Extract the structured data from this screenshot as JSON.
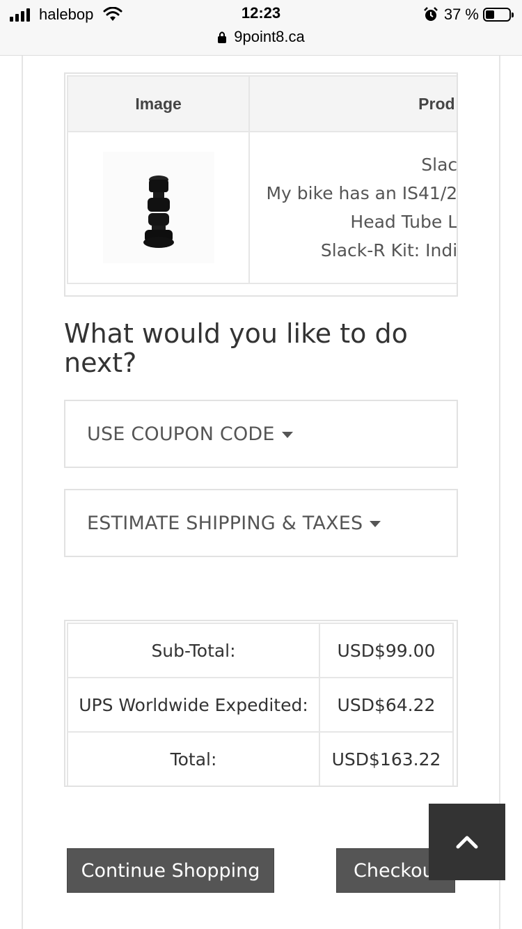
{
  "status_bar": {
    "carrier": "halebop",
    "time": "12:23",
    "battery_percent": "37 %",
    "battery_level": 0.37,
    "url": "9point8.ca"
  },
  "cart_table": {
    "headers": [
      "Image",
      "Prod"
    ],
    "product_lines": [
      "Slac",
      "My bike has an IS41/2",
      "Head Tube L",
      "Slack-R Kit: Indi"
    ],
    "product_image": "headset-spacer-stack-image"
  },
  "next_heading": "What would you like to do next?",
  "panels": {
    "coupon": "USE COUPON CODE",
    "shipping": "ESTIMATE SHIPPING & TAXES"
  },
  "totals": [
    {
      "label": "Sub-Total:",
      "value": "USD$99.00"
    },
    {
      "label": "UPS Worldwide Expedited:",
      "value": "USD$64.22"
    },
    {
      "label": "Total:",
      "value": "USD$163.22"
    }
  ],
  "buttons": {
    "continue": "Continue Shopping",
    "checkout": "Checkout"
  },
  "colors": {
    "button_bg": "#555555",
    "back_to_top_bg": "#333333",
    "border": "#e2e2e2"
  }
}
